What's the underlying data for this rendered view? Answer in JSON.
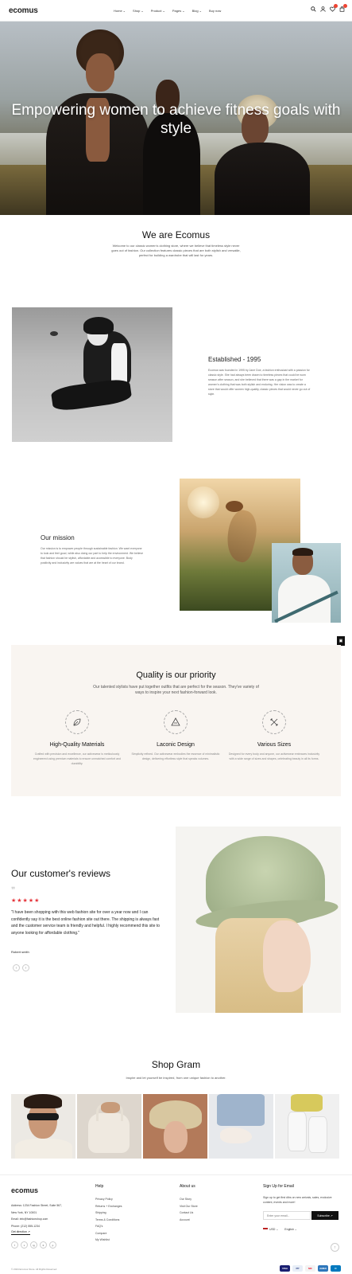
{
  "header": {
    "logo": "ecomus",
    "nav": [
      "Home",
      "Shop",
      "Product",
      "Pages",
      "Blog",
      "Buy now"
    ]
  },
  "hero": {
    "title": "Empowering women to achieve fitness goals with style"
  },
  "about": {
    "title": "We are Ecomus",
    "text": "Welcome to our classic women's clothing store, where we believe that timeless style never goes out of fashion. Our collection features classic pieces that are both stylish and versatile, perfect for building a wardrobe that will last for years."
  },
  "established": {
    "title": "Established - 1995",
    "text": "Ecomus was founded in 1995 by Jane Doe, a fashion enthusiast with a passion for classic style. She had always been drawn to timeless pieces that could be worn season after season, and she believed that there was a gap in the market for women's clothing that was both stylish and enduring. Her vision was to create a store that would offer women high-quality, classic pieces that would never go out of style."
  },
  "mission": {
    "title": "Our mission",
    "text": "Our mission is to empower people through sustainable fashion. We want everyone to look and feel good, while also doing our part to help the environment. We believe that fashion should be stylish, affordable and accessible to everyone. Body positivity and inclusivity are values that are at the heart of our brand."
  },
  "quality": {
    "title": "Quality is our priority",
    "subtitle": "Our talented stylists have put together outfits that are perfect for the season. They've variety of ways to inspire your next fashion-forward look.",
    "items": [
      {
        "name": "High-Quality Materials",
        "desc": "Crafted with precision and excellence, our activewear is meticulously engineered using premium materials to ensure unmatched comfort and durability.",
        "icon": "leaf-icon"
      },
      {
        "name": "Laconic Design",
        "desc": "Simplicity refined. Our activewear embodies the essence of minimalistic design, delivering effortless style that speaks volumes.",
        "icon": "diamond-icon"
      },
      {
        "name": "Various Sizes",
        "desc": "Designed for every body and anyone, our activewear embraces inclusivity with a wide range of sizes and shapes, celebrating beauty in all its forms.",
        "icon": "arrows-icon"
      }
    ]
  },
  "reviews": {
    "title": "Our customer's reviews",
    "rating": 5,
    "stars": "★★★★★",
    "text": "\"I have been shopping with this web fashion site for over a year now and I can confidently say it is the best online fashion site out there. The shipping is always fast and the customer service team is friendly and helpful. I highly recommend this site to anyone looking for affordable clothing.\"",
    "author": "Robert smith",
    "prev": "‹",
    "next": "›"
  },
  "shopgram": {
    "title": "Shop Gram",
    "subtitle": "Inspire and let yourself be inspired, from one unique fashion to another."
  },
  "footer": {
    "logo": "ecomus",
    "address": [
      "Address: 1234 Fashion Street, Suite 567,",
      "New York, NY 10001",
      "Email: info@fashionshop.com",
      "Phone: (212) 555-1234"
    ],
    "directions": "Get direction ↗",
    "social": [
      "f",
      "x",
      "ig",
      "tt",
      "p"
    ],
    "help": {
      "title": "Help",
      "links": [
        "Privacy Policy",
        "Returns + Exchanges",
        "Shipping",
        "Terms & Conditions",
        "FAQ's",
        "Compare",
        "My Wishlist"
      ]
    },
    "about": {
      "title": "About us",
      "links": [
        "Our Story",
        "Visit Our Store",
        "Contact Us",
        "Account"
      ]
    },
    "signup": {
      "title": "Sign Up for Email",
      "text": "Sign up to get first dibs on new arrivals, sales, exclusive content, events and more!",
      "placeholder": "Enter your email...",
      "button": "Subscribe ↗"
    },
    "currency": "USD ⌄",
    "language": "English ⌄",
    "copyright": "© 2024 Ecomus Store. All Rights Reserved",
    "payments": [
      "VISA",
      "PP",
      "MC",
      "AMEX",
      "D"
    ]
  },
  "colors": {
    "accent": "#e5343a",
    "quality_bg": "#f9f5f1"
  }
}
